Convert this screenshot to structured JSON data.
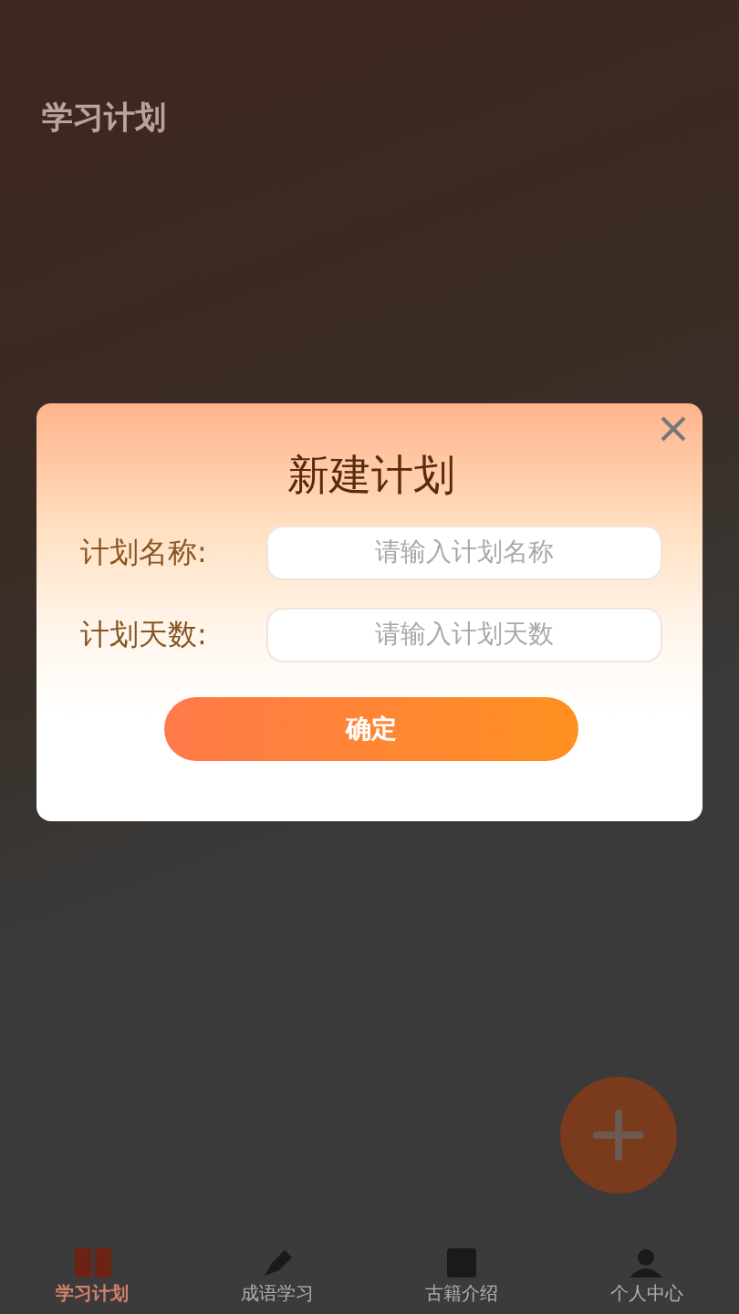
{
  "page": {
    "title": "学习计划"
  },
  "dialog": {
    "title": "新建计划",
    "fields": [
      {
        "label": "计划名称:",
        "placeholder": "请输入计划名称"
      },
      {
        "label": "计划天数:",
        "placeholder": "请输入计划天数"
      }
    ],
    "confirm": "确定"
  },
  "tabs": [
    {
      "label": "学习计划",
      "selected": true,
      "kind": "book"
    },
    {
      "label": "成语学习",
      "selected": false,
      "kind": "pen"
    },
    {
      "label": "古籍介绍",
      "selected": false,
      "kind": "album"
    },
    {
      "label": "个人中心",
      "selected": false,
      "kind": "person"
    }
  ]
}
